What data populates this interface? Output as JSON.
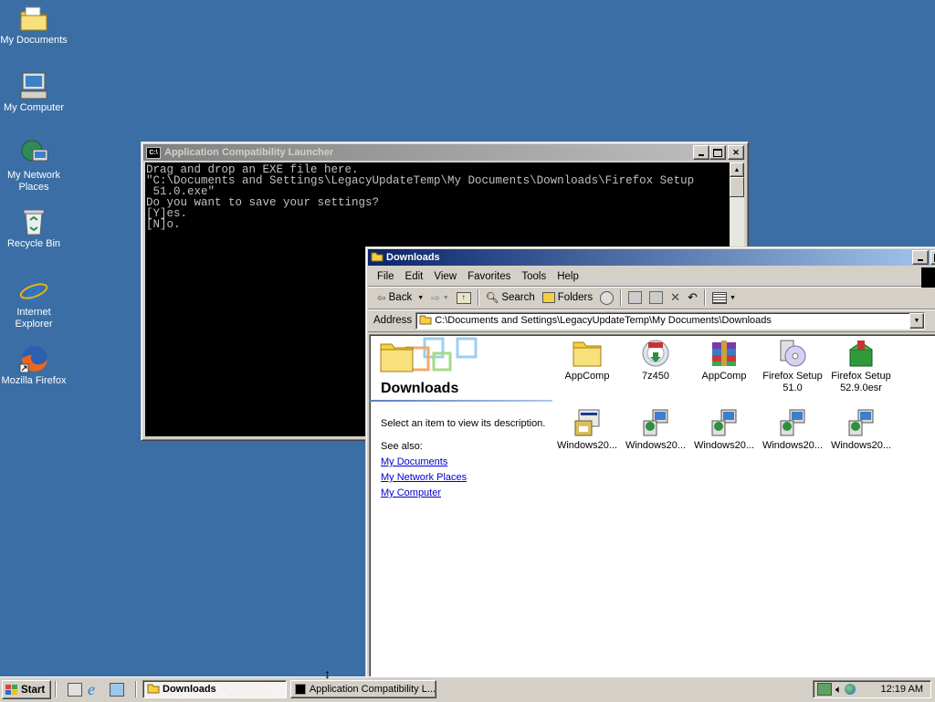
{
  "desktop": {
    "icons": [
      {
        "label": "My Documents",
        "icon": "my-documents-icon"
      },
      {
        "label": "My Computer",
        "icon": "my-computer-icon"
      },
      {
        "label": "My Network Places",
        "icon": "network-places-icon"
      },
      {
        "label": "Recycle Bin",
        "icon": "recycle-bin-icon"
      },
      {
        "label": "Internet Explorer",
        "icon": "internet-explorer-icon"
      },
      {
        "label": "Mozilla Firefox",
        "icon": "firefox-icon"
      }
    ]
  },
  "console_window": {
    "title": "Application Compatibility Launcher",
    "lines": [
      "Drag and drop an EXE file here.",
      "",
      "\"C:\\Documents and Settings\\LegacyUpdateTemp\\My Documents\\Downloads\\Firefox Setup",
      " 51.0.exe\"",
      "",
      "Do you want to save your settings?",
      "",
      "[Y]es.",
      "[N]o."
    ]
  },
  "explorer": {
    "title": "Downloads",
    "menu": [
      "File",
      "Edit",
      "View",
      "Favorites",
      "Tools",
      "Help"
    ],
    "toolbar": {
      "back": "Back",
      "search": "Search",
      "folders": "Folders"
    },
    "address_label": "Address",
    "address_value": "C:\\Documents and Settings\\LegacyUpdateTemp\\My Documents\\Downloads",
    "side_panel": {
      "folder_title": "Downloads",
      "description": "Select an item to view its description.",
      "see_also": "See also:",
      "links": [
        "My Documents",
        "My Network Places",
        "My Computer"
      ]
    },
    "files": [
      {
        "label": "AppComp",
        "icon": "folder-icon"
      },
      {
        "label": "7z450",
        "icon": "installer-icon"
      },
      {
        "label": "AppComp",
        "icon": "winrar-archive-icon"
      },
      {
        "label": "Firefox Setup 51.0",
        "icon": "setup-cd-icon"
      },
      {
        "label": "Firefox Setup 52.9.0esr",
        "icon": "setup-box-icon"
      },
      {
        "label": "Windows20...",
        "icon": "setup-program-icon"
      },
      {
        "label": "Windows20...",
        "icon": "windows-update-package-icon"
      },
      {
        "label": "Windows20...",
        "icon": "windows-update-package-icon"
      },
      {
        "label": "Windows20...",
        "icon": "windows-update-package-icon"
      },
      {
        "label": "Windows20...",
        "icon": "windows-update-package-icon"
      }
    ]
  },
  "taskbar": {
    "start_label": "Start",
    "tasks": [
      {
        "label": "Downloads",
        "icon": "folder-icon"
      },
      {
        "label": "Application Compatibility L...",
        "icon": "console-icon"
      }
    ],
    "clock": "12:19 AM"
  },
  "colors": {
    "desktop": "#3a6ea5",
    "active_title_start": "#0a246a",
    "active_title_end": "#a6caf0",
    "inactive_title_start": "#808080",
    "face": "#d4d0c8",
    "link": "#0000cc"
  }
}
